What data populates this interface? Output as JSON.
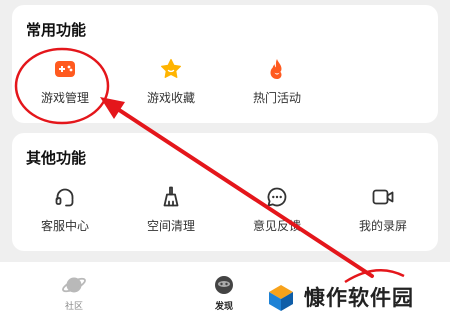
{
  "common": {
    "title": "常用功能",
    "items": [
      {
        "label": "游戏管理",
        "icon": "gamepad-icon",
        "color": "#ff5a1f"
      },
      {
        "label": "游戏收藏",
        "icon": "star-icon",
        "color": "#ffb400"
      },
      {
        "label": "热门活动",
        "icon": "flame-icon",
        "color": "#ff5a1f"
      }
    ]
  },
  "other": {
    "title": "其他功能",
    "items": [
      {
        "label": "客服中心",
        "icon": "headset-icon"
      },
      {
        "label": "空间清理",
        "icon": "broom-icon"
      },
      {
        "label": "意见反馈",
        "icon": "chat-bubble-icon"
      },
      {
        "label": "我的录屏",
        "icon": "video-camera-icon"
      }
    ]
  },
  "tabbar": {
    "tabs": [
      {
        "label": "社区",
        "icon": "planet-icon",
        "active": false
      },
      {
        "label": "发现",
        "icon": "discover-icon",
        "active": true
      }
    ]
  },
  "watermark": {
    "text": "慷作软件园"
  },
  "colors": {
    "accent": "#ff5a1f",
    "star": "#ffb400",
    "annotation": "#e4161b",
    "background": "#efefef"
  }
}
